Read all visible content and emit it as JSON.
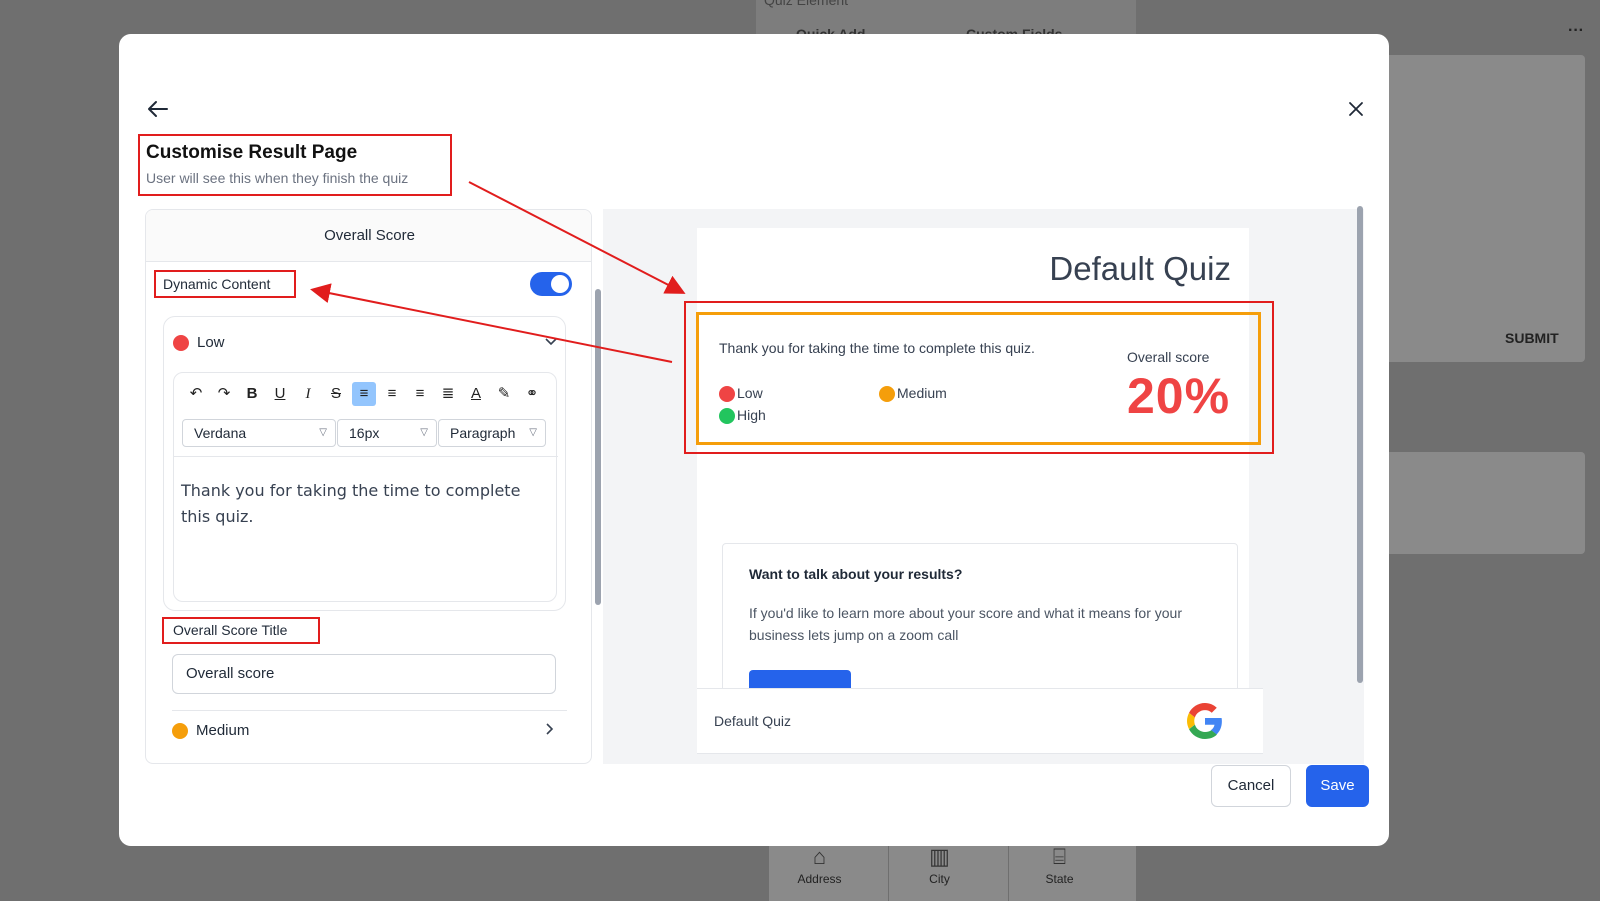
{
  "background": {
    "panel_title": "Quiz Element",
    "tabs": [
      "Quick Add",
      "Custom Fields"
    ],
    "menu_dots": "···",
    "submit_label": "SUBMIT",
    "fields": [
      "Address",
      "City",
      "State"
    ]
  },
  "modal": {
    "title": "Customise Result Page",
    "subtitle": "User will see this when they finish the quiz",
    "cancel_label": "Cancel",
    "save_label": "Save"
  },
  "left": {
    "header": "Overall Score",
    "dynamic_content_label": "Dynamic Content",
    "dynamic_content_enabled": true,
    "levels": [
      {
        "label": "Low",
        "color": "#ef4444",
        "expanded": true
      },
      {
        "label": "Medium",
        "color": "#f59e0b",
        "expanded": false
      }
    ],
    "editor": {
      "font": "Verdana",
      "size": "16px",
      "block": "Paragraph",
      "text": "Thank you for taking the time to complete this quiz."
    },
    "overall_score_title_label": "Overall Score Title",
    "overall_score_title_value": "Overall score"
  },
  "preview": {
    "quiz_title": "Default Quiz",
    "result_text": "Thank you for taking the time to complete this quiz.",
    "legend": [
      {
        "label": "Low",
        "color": "#ef4444"
      },
      {
        "label": "Medium",
        "color": "#f59e0b"
      },
      {
        "label": "High",
        "color": "#22c55e"
      }
    ],
    "score_title": "Overall score",
    "score_value": "20%",
    "talk_title": "Want to talk about your results?",
    "talk_body": "If you'd like to learn more about your score and what it means for your business lets jump on a zoom call",
    "footer_name": "Default Quiz"
  },
  "colors": {
    "accent": "#2563eb",
    "annotation": "#e11d1d",
    "highlight": "#f59e0b"
  }
}
